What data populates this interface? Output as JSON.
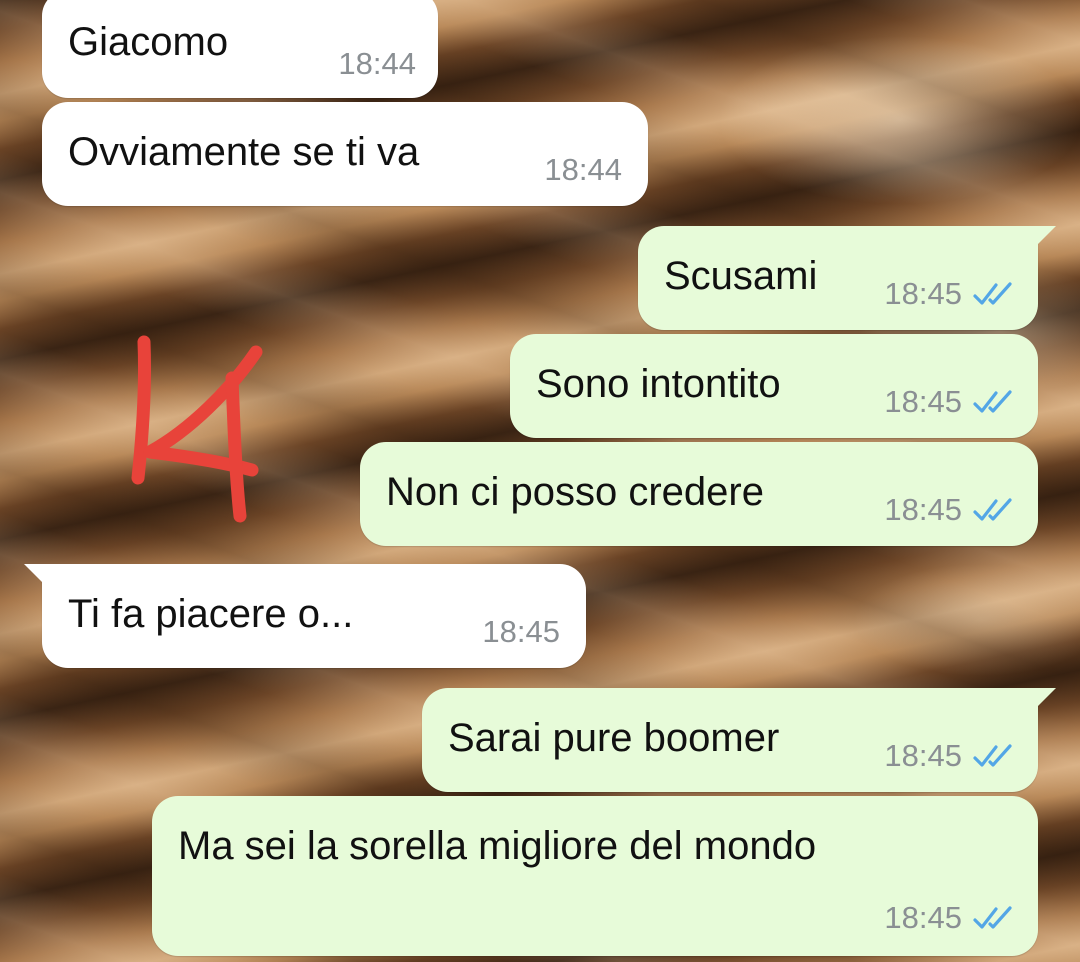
{
  "chat": {
    "messages": [
      {
        "direction": "incoming",
        "text": "Giacomo",
        "time": "18:44"
      },
      {
        "direction": "incoming",
        "text": "Ovviamente se ti va",
        "time": "18:44"
      },
      {
        "direction": "outgoing",
        "text": "Scusami",
        "time": "18:45",
        "status": "read"
      },
      {
        "direction": "outgoing",
        "text": "Sono intontito",
        "time": "18:45",
        "status": "read"
      },
      {
        "direction": "outgoing",
        "text": "Non ci posso credere",
        "time": "18:45",
        "status": "read"
      },
      {
        "direction": "incoming",
        "text": "Ti fa piacere o...",
        "time": "18:45"
      },
      {
        "direction": "outgoing",
        "text": "Sarai pure boomer",
        "time": "18:45",
        "status": "read"
      },
      {
        "direction": "outgoing",
        "text": "Ma sei la sorella migliore del mondo",
        "time": "18:45",
        "status": "read"
      }
    ]
  },
  "colors": {
    "incoming_bubble": "#ffffff",
    "outgoing_bubble": "#e7fbd9",
    "read_ticks": "#53a6e6",
    "annotation": "#e8433a"
  },
  "icons": {
    "read_receipt": "double-check-icon",
    "annotation": "handwritten-mark"
  }
}
